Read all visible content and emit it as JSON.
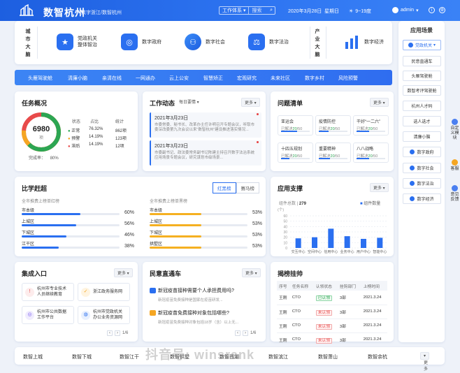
{
  "header": {
    "brand": "数智杭州",
    "subtitle": "数字浙江/数智杭州",
    "search_scope": "工作体系",
    "search_placeholder": "搜索",
    "date": "2020年3月28日",
    "weekday": "星期日",
    "weather": "9~19度",
    "user": "admin"
  },
  "top_modules": {
    "left_label": "城\n市\n大\n脑",
    "right_label": "产\n业\n大\n脑",
    "items": [
      {
        "label": "党政机关\n整体智治",
        "icon": "party-badge-icon"
      },
      {
        "label": "数字政府",
        "icon": "gov-icon"
      },
      {
        "label": "数字社会",
        "icon": "society-icon"
      },
      {
        "label": "数字法治",
        "icon": "gavel-icon"
      },
      {
        "label": "数字经济",
        "icon": "bar-chart-icon"
      }
    ]
  },
  "nav": [
    "头雁驾驶舱",
    "清廉小脑",
    "亲清在线",
    "一网通办",
    "云上公安",
    "智慧矫正",
    "宏观研究",
    "未来社区",
    "数字乡村",
    "风险预警"
  ],
  "task": {
    "title": "任务概况",
    "total": "6980",
    "unit": "项",
    "headers": [
      "状态",
      "占比",
      "统计"
    ],
    "rows": [
      {
        "name": "正常",
        "pct": "76.32%",
        "count": "862项",
        "color": "#2ca653"
      },
      {
        "name": "预警",
        "pct": "14.19%",
        "count": "123项",
        "color": "#f5a623"
      },
      {
        "name": "滞后",
        "pct": "14.19%",
        "count": "12项",
        "color": "#e84a4a"
      }
    ],
    "completion_label": "完成率：",
    "completion": "80%",
    "completion_value": 0.8
  },
  "work": {
    "title": "工作动态",
    "filter": "每日要情",
    "more": "更多",
    "items": [
      {
        "date": "2021年3月23日",
        "text": "市委常委、秘书长、改革办主任许明召开专题会议，听取市委深改委第九次会议以来“数智杭州”建设推进落实情况..."
      },
      {
        "date": "2021年3月23日",
        "text": "市委副书记、政法委常务副书记陈建主持召开数字法治系统应用场景专题会议，研究谋划市级场景..."
      }
    ]
  },
  "issues": {
    "title": "问题清单",
    "more": "更多",
    "items": [
      {
        "name": "亚运会",
        "done": "20",
        "total": "50",
        "progress": 0.55
      },
      {
        "name": "疫情防控",
        "done": "20",
        "total": "50",
        "progress": 0.35
      },
      {
        "name": "干好“一二六”",
        "done": "20",
        "total": "50",
        "progress": 0.45
      },
      {
        "name": "十四五规划",
        "done": "20",
        "total": "50",
        "progress": 0.3
      },
      {
        "name": "重要精神",
        "done": "20",
        "total": "50",
        "progress": 0.4
      },
      {
        "name": "八八战略",
        "done": "20",
        "total": "50",
        "progress": 0.45
      }
    ],
    "solved_label": "已解决"
  },
  "compare": {
    "title": "比学赶超",
    "tabs": [
      "红黑榜",
      "赛马榜"
    ],
    "left": {
      "subtitle": "全市推费上榜单红榜",
      "rows": [
        {
          "name": "市本级",
          "pct": "60%",
          "value": 0.6
        },
        {
          "name": "上城区",
          "pct": "56%",
          "value": 0.56
        },
        {
          "name": "下城区",
          "pct": "46%",
          "value": 0.46
        },
        {
          "name": "江干区",
          "pct": "38%",
          "value": 0.38
        }
      ]
    },
    "right": {
      "subtitle": "全市推费上榜单黑榜",
      "rows": [
        {
          "name": "市本级",
          "pct": "53%",
          "value": 0.53
        },
        {
          "name": "上城区",
          "pct": "53%",
          "value": 0.53
        },
        {
          "name": "下城区",
          "pct": "53%",
          "value": 0.53
        },
        {
          "name": "拱墅区",
          "pct": "53%",
          "value": 0.53
        }
      ]
    }
  },
  "apps": {
    "title": "应用支撑",
    "more": "更多",
    "sub_label": "组件总数",
    "sub_value": "279",
    "legend": "组件数量",
    "ylabel": "(个)"
  },
  "chart_data": {
    "type": "bar",
    "categories": [
      "交互中心",
      "空间中心",
      "信用中心",
      "业务中心",
      "用户中心",
      "智能中心"
    ],
    "series": [
      {
        "name": "组件数量",
        "values": [
          18,
          20,
          36,
          22,
          17,
          19
        ]
      }
    ],
    "ylim": [
      0,
      60
    ],
    "yticks": [
      "0",
      "10",
      "20",
      "30",
      "40",
      "50",
      "60"
    ],
    "ylabel": "(个)"
  },
  "integration": {
    "title": "集成入口",
    "more": "更多",
    "page": "1/6",
    "items": [
      {
        "label": "杭州市专业技术\n人员继续教育",
        "color": "#e84a4a",
        "icon": "warning-icon"
      },
      {
        "label": "浙江政务服务网",
        "color": "#f5a623",
        "icon": "check-icon"
      },
      {
        "label": "杭州市公共数据\n工作平台",
        "color": "#7b5cf0",
        "icon": "target-icon"
      },
      {
        "label": "杭州市党政机关\n办公业务资源网",
        "color": "#2a6ff0",
        "icon": "globe-icon"
      }
    ]
  },
  "news": {
    "title": "民意直通车",
    "more": "更多",
    "page": "1/6",
    "items": [
      {
        "q": "新冠疫苗接种需要个人承担费用吗?",
        "a": "新冠疫苗免费接种是国家在疫苗研发...",
        "color": "#2a6ff0"
      },
      {
        "q": "新冠疫苗免费接种对象包括哪些?",
        "a": "新冠疫苗免费接种对象包括18岁（含）以上无...",
        "color": "#f5a623"
      }
    ]
  },
  "leaders": {
    "title": "揭榜挂帅",
    "headers": [
      "序号",
      "任务名称",
      "认领状态",
      "挂钩部门",
      "上榜时间"
    ],
    "rows": [
      {
        "a": "王刚",
        "b": "CTO",
        "c": "已认领",
        "d": "3部",
        "e": "2021.3.24",
        "ok": true
      },
      {
        "a": "王刚",
        "b": "CTO",
        "c": "未认领",
        "d": "3部",
        "e": "2021.3.24",
        "ok": false
      },
      {
        "a": "王刚",
        "b": "CTO",
        "c": "未认领",
        "d": "3部",
        "e": "2021.3.24",
        "ok": false
      },
      {
        "a": "王刚",
        "b": "CTO",
        "c": "未认领",
        "d": "3部",
        "e": "2021.3.24",
        "ok": false
      }
    ]
  },
  "sidebar": {
    "title": "应用场景",
    "items": [
      {
        "label": "党政机关",
        "dot": true
      },
      {
        "label": "民意直通车"
      },
      {
        "label": "头雁驾驶舱"
      },
      {
        "label": "数智考评驾驶舱"
      },
      {
        "label": "杭州人才码"
      },
      {
        "label": "选人选才"
      },
      {
        "label": "清廉小脑"
      },
      {
        "label": "数字政府",
        "dot": true
      },
      {
        "label": "数字社会",
        "dot": true
      },
      {
        "label": "数字法治",
        "dot": true
      },
      {
        "label": "数字经济",
        "dot": true
      }
    ]
  },
  "float": [
    {
      "label": "自定义模块"
    },
    {
      "label": "客服"
    },
    {
      "label": "意见反馈"
    }
  ],
  "bottom": {
    "items": [
      "数智上城",
      "数智下城",
      "数智江干",
      "数智拱墅",
      "数智西湖",
      "数智滨江",
      "数智萧山",
      "数智余杭"
    ],
    "more": "更多"
  },
  "watermark": "抖音号: winsrank"
}
